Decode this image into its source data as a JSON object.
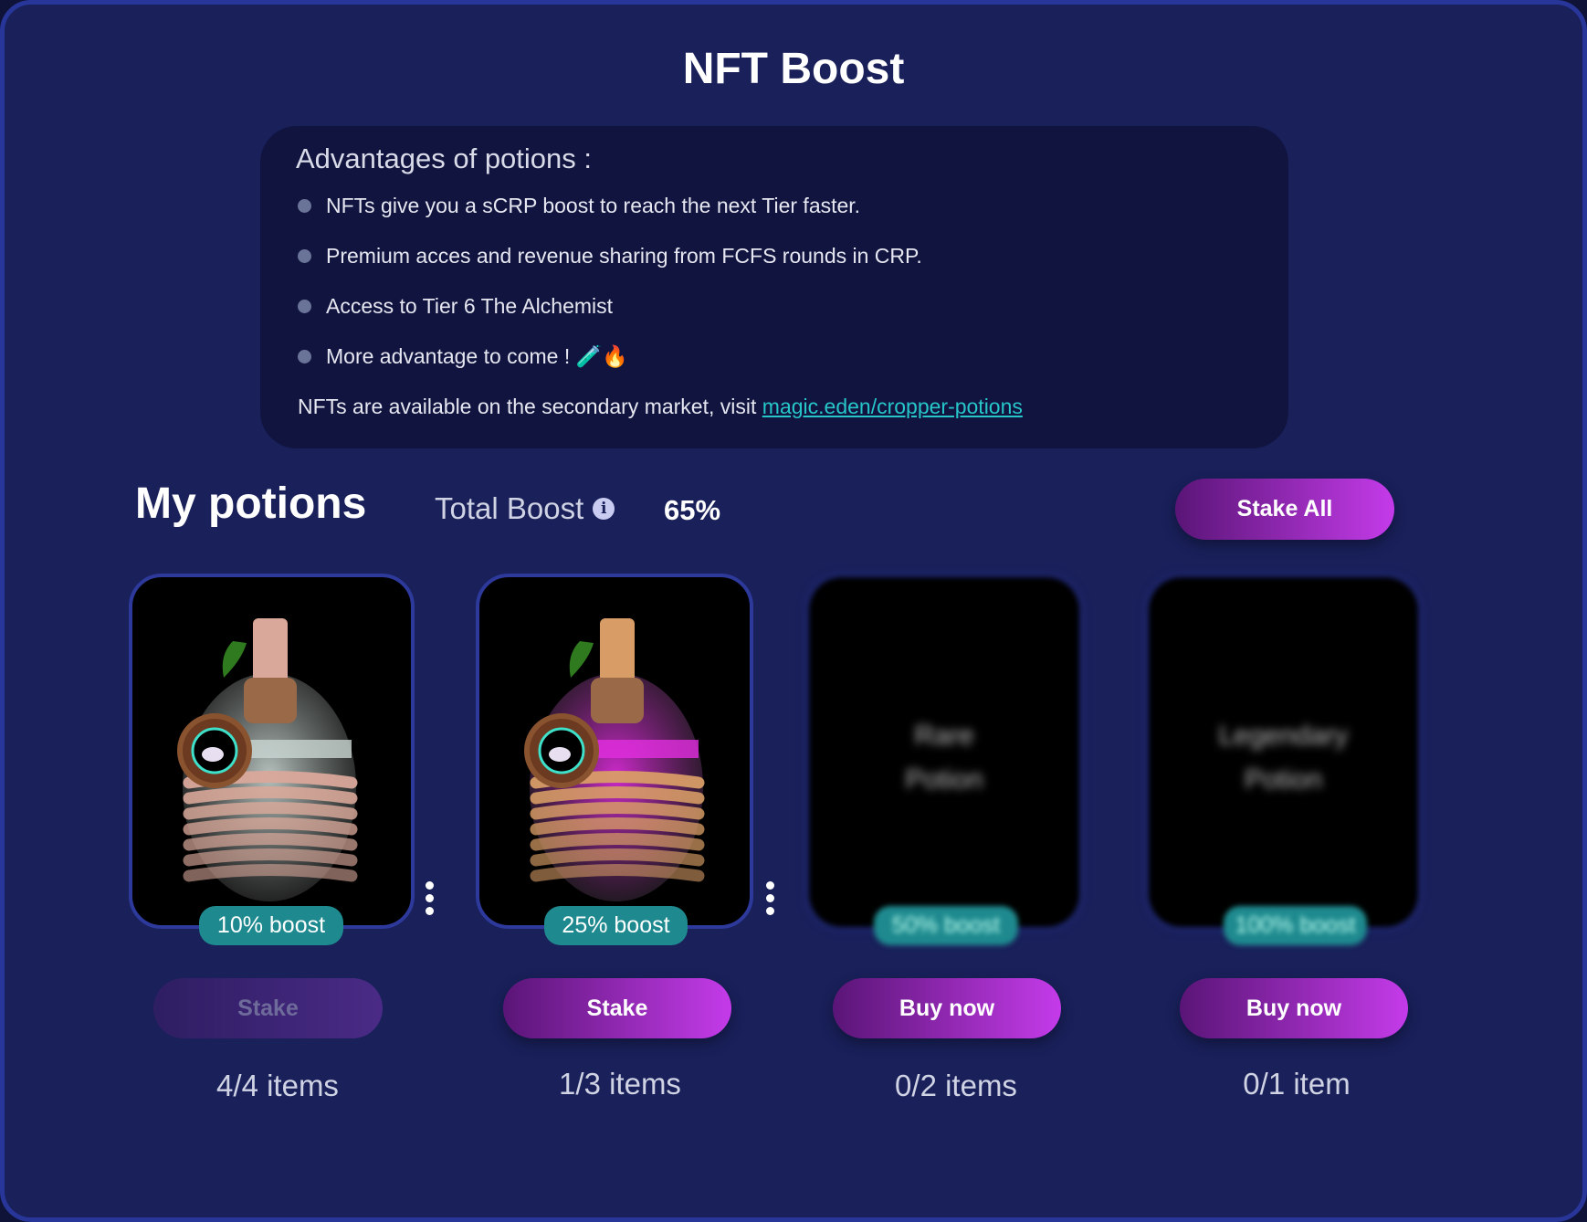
{
  "title": "NFT Boost",
  "advantages": {
    "heading": "Advantages of potions :",
    "items": [
      "NFTs give you a sCRP boost to reach the next Tier faster.",
      "Premium acces and revenue sharing from FCFS rounds in CRP.",
      "Access to Tier 6 The Alchemist",
      "More advantage to come ! 🧪🔥"
    ],
    "footer_text": "NFTs are available on the secondary market, visit ",
    "footer_link": "magic.eden/cropper-potions"
  },
  "potions": {
    "heading": "My potions",
    "total_boost_label": "Total Boost",
    "total_boost_value": "65%",
    "stake_all_label": "Stake All",
    "cards": [
      {
        "badge": "10% boost",
        "button": "Stake",
        "items": "4/4 items",
        "liquid": "#c9d6d2",
        "cord": "#d9a89a"
      },
      {
        "badge": "25% boost",
        "button": "Stake",
        "items": "1/3 items",
        "liquid": "#e22ee0",
        "cord": "#d89c66"
      },
      {
        "name_line1": "Rare",
        "name_line2": "Potion",
        "badge": "50% boost",
        "button": "Buy now",
        "items": "0/2 items"
      },
      {
        "name_line1": "Legendary",
        "name_line2": "Potion",
        "badge": "100% boost",
        "button": "Buy now",
        "items": "0/1 item"
      }
    ]
  },
  "colors": {
    "background": "#19205a",
    "panel": "#10143f",
    "badge": "#1e8a8f",
    "link": "#27c6c9",
    "button_start": "#5a1577",
    "button_end": "#c43be9"
  }
}
